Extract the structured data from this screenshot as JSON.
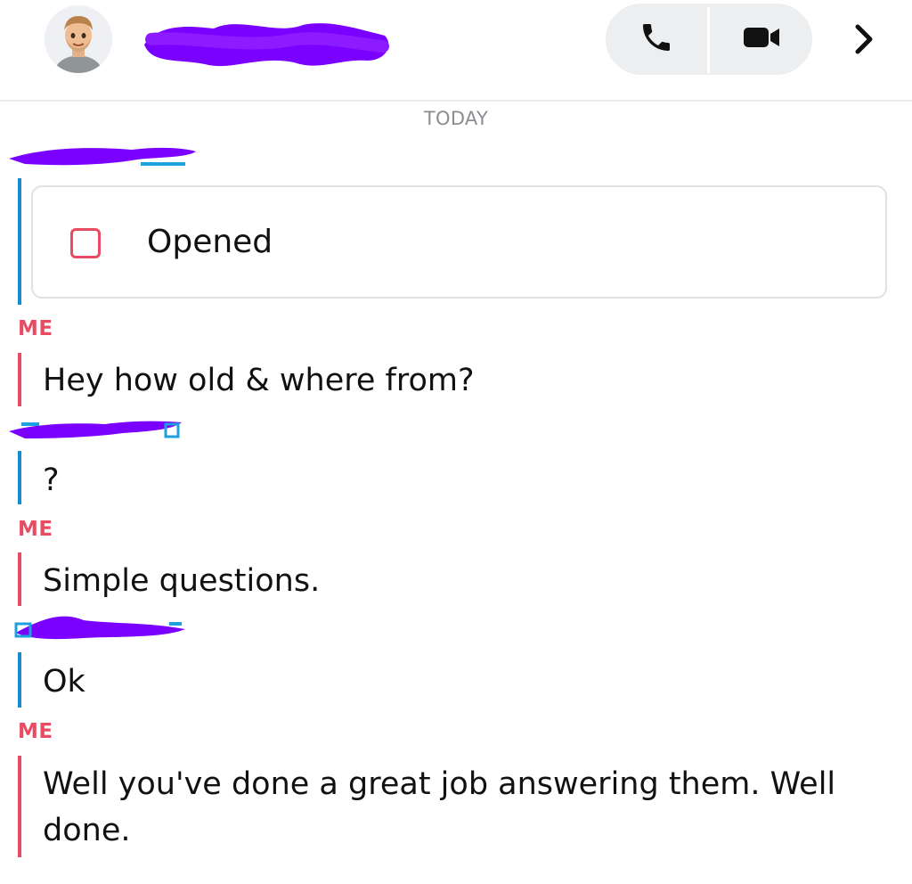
{
  "header": {
    "avatar_icon": "bitmoji-avatar-icon",
    "contact_name": "",
    "phone_icon": "phone-icon",
    "video_icon": "video-camera-icon",
    "chevron_icon": "chevron-right-icon"
  },
  "date_separator": "TODAY",
  "messages": [
    {
      "sender": "",
      "text": ""
    },
    {
      "sender": "ME",
      "text": "Hey how old & where from?"
    },
    {
      "sender": "",
      "text": "?"
    },
    {
      "sender": "ME",
      "text": "Simple questions."
    },
    {
      "sender": "",
      "text": "Ok"
    },
    {
      "sender": "ME",
      "text": "Well you've done a great job answering them. Well done."
    }
  ],
  "opened_card": {
    "label": "Opened",
    "icon": "unopened-snap-square-icon"
  },
  "colors": {
    "me": "#e84b62",
    "them": "#1da1dc",
    "them_bar": "#1a8ad1",
    "redaction": "#7a00ff"
  }
}
